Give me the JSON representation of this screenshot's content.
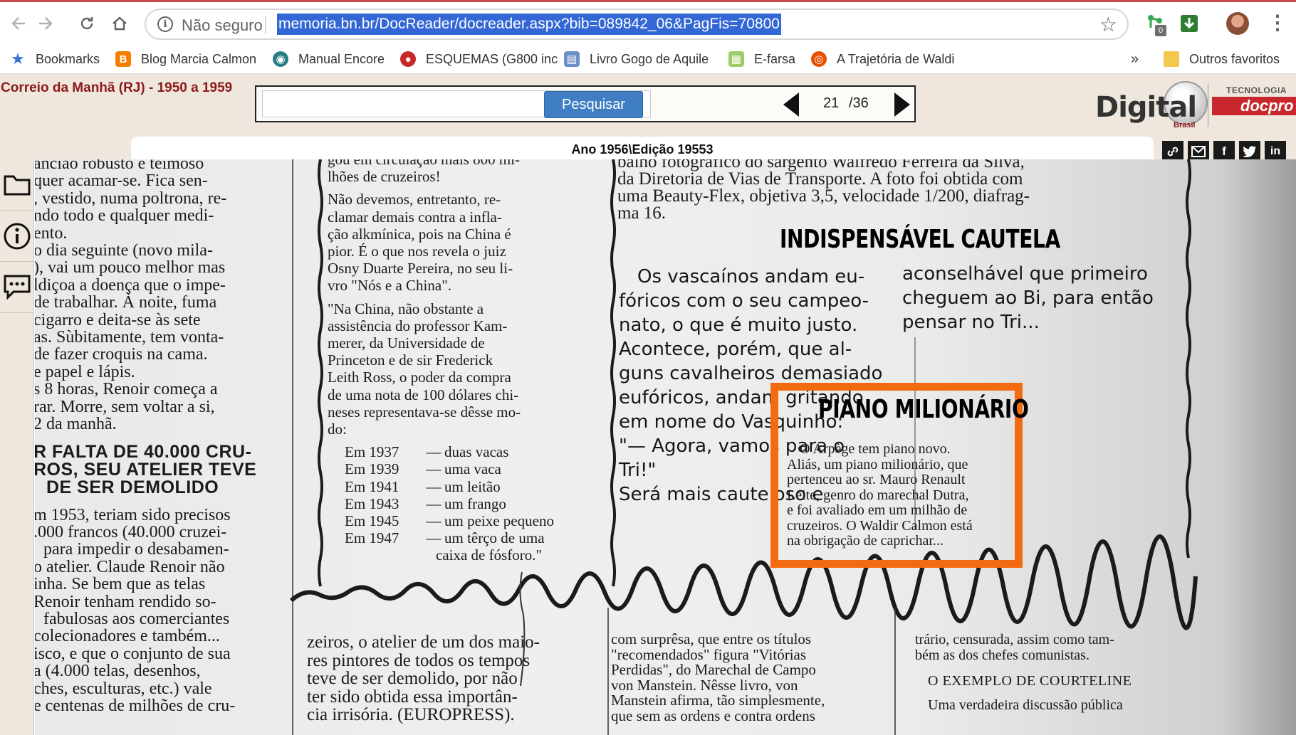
{
  "browser": {
    "omnibox": {
      "security_label": "Não seguro",
      "url": "memoria.bn.br/DocReader/docreader.aspx?bib=089842_06&PagFis=70800"
    },
    "extension_badge": "0",
    "bookmarks": [
      {
        "label": "Bookmarks",
        "icon": "star-icon"
      },
      {
        "label": "Blog Marcia Calmon",
        "icon": "blogger-icon"
      },
      {
        "label": "Manual Encore",
        "icon": "globe-icon"
      },
      {
        "label": "ESQUEMAS (G800 inc",
        "icon": "ladybug-icon"
      },
      {
        "label": "Livro Gogo de Aquile",
        "icon": "document-icon"
      },
      {
        "label": "E-farsa",
        "icon": "e-farsa-icon"
      },
      {
        "label": "A Trajetória de Waldi",
        "icon": "circle-logo-icon"
      }
    ],
    "overflow_label": "»",
    "other_bookmarks": "Outros favoritos"
  },
  "site": {
    "collection_title": "Correio da Manhã (RJ) - 1950 a 1959",
    "search": {
      "placeholder": "",
      "button_label": "Pesquisar"
    },
    "pagination": {
      "current": "21",
      "total": "/36"
    },
    "logo": {
      "word": "Digital",
      "brand_sub": "Brasil",
      "tech_label": "TECNOLOGIA",
      "tech_brand": "docpro"
    },
    "edition_label": "Ano 1956\\Edição 19553",
    "accent_color": "#3f7ec2",
    "highlight_color": "#f36b10"
  },
  "newspaper": {
    "col1": {
      "lines_a": [
        "ancião robusto e teimoso",
        "quer acamar-se. Fica sen-",
        ", vestido, numa poltrona, re-",
        "ndo todo e qualquer medi-",
        "ento.",
        "o dia seguinte (novo mila-",
        "), vai um pouco melhor mas",
        "ldiçoa a doença que o impe-",
        "de trabalhar. À noite, fuma",
        "cigarro e deita-se às sete",
        "as. Sùbitamente, tem vonta-",
        "de fazer croquis na cama.",
        "e papel e lápis.",
        "s 8 horas, Renoir começa a",
        "rar. Morre, sem voltar a si,",
        "2 da manhã."
      ],
      "head": [
        "R FALTA DE 40.000 CRU-",
        "ROS, SEU ATELIER TEVE",
        "DE SER DEMOLIDO"
      ],
      "lines_b": [
        "m 1953, teriam sido precisos",
        ".000 francos (40.000 cruzei-",
        "para impedir o desabamen-",
        "o atelier. Claude Renoir não",
        "inha. Se bem que as telas",
        "Renoir tenham rendido so-",
        "fabulosas aos comerciantes",
        "colecionadores e também...",
        "isco, e que o conjunto de sua",
        "a (4.000 telas, desenhos,",
        "ches, esculturas, etc.) vale",
        "e centenas de milhões de cru-"
      ]
    },
    "col2": {
      "lines_a": [
        "gou em circulação mais 800 mi-",
        "lhões de cruzeiros!",
        "  Não devemos, entretanto, re-",
        "clamar demais contra a infla-",
        "ção alkmínica, pois na China é",
        "pior. É o que nos revela o juiz",
        "Osny Duarte Pereira, no seu li-",
        "vro \"Nós e a China\".",
        "  \"Na China, não obstante a",
        "assistência do professor Kam-",
        "merer, da Universidade de",
        "Princeton e de sir Frederick",
        "Leith Ross, o poder da compra",
        "de uma nota de 100 dólares chi-",
        "neses representava-se dêsse mo-",
        "do:"
      ],
      "list": [
        {
          "year": "Em 1937",
          "item": "duas vacas"
        },
        {
          "year": "Em 1939",
          "item": "uma vaca"
        },
        {
          "year": "Em 1941",
          "item": "um leitão"
        },
        {
          "year": "Em 1943",
          "item": "um frango"
        },
        {
          "year": "Em 1945",
          "item": "um peixe pequeno"
        },
        {
          "year": "Em 1947",
          "item": "um têrço de uma"
        }
      ],
      "list_tail": "caixa de fósforo.\""
    },
    "col3": {
      "top_lines": [
        "balho fotográfico do sargento Walfredo Ferreira da Silva,",
        "da Diretoria de Vias de Transporte. A foto foi obtida com",
        "uma Beauty-Flex, objetiva 3,5, velocidade 1/200, diafrag-",
        "ma 16."
      ],
      "headline": "INDISPENSÁVEL CAUTELA",
      "left_lines": [
        "Os vascaínos andam eu-",
        "fóricos com o seu campeo-",
        "nato, o que é muito justo.",
        "Acontece, porém, que al-",
        "guns cavalheiros demasiado",
        "eufóricos, andam gritando",
        "em nome do Vasquinho:",
        "  \"— Agora, vamos para o",
        "Tri!\"",
        "  Será mais cauteloso e"
      ],
      "right_lines": [
        "aconselhável que primeiro",
        "cheguem ao Bi, para então",
        "pensar no Tri..."
      ],
      "box_title": "PIANO MILIONÁRIO",
      "box_lines": [
        "  O Arpège tem piano novo.",
        "Aliás, um piano milionário, que",
        "pertenceu ao sr. Mauro Renault",
        "Leite, genro do marechal Dutra,",
        "e foi avaliado em um milhão de",
        "cruzeiros. O Waldir Calmon está",
        "na obrigação de caprichar..."
      ]
    },
    "bottom": {
      "b2": [
        "zeiros, o atelier de um dos maio-",
        "res pintores de todos os tempos",
        "teve de ser demolido, por não",
        "ter sido obtida essa importân-",
        "cia irrisória. (EUROPRESS)."
      ],
      "b3": [
        "com surprêsa, que entre os títulos",
        "\"recomendados\" figura \"Vitórias",
        "Perdidas\", do Marechal de Campo",
        "von Manstein. Nêsse livro, von",
        "Manstein afirma, tão simplesmente,",
        "que sem as ordens e contra ordens"
      ],
      "b4a": [
        "trário, censurada, assim como tam-",
        "bém as dos chefes comunistas."
      ],
      "b4head": "O EXEMPLO DE COURTELINE",
      "b4b": [
        "Uma verdadeira discussão pública"
      ]
    }
  }
}
